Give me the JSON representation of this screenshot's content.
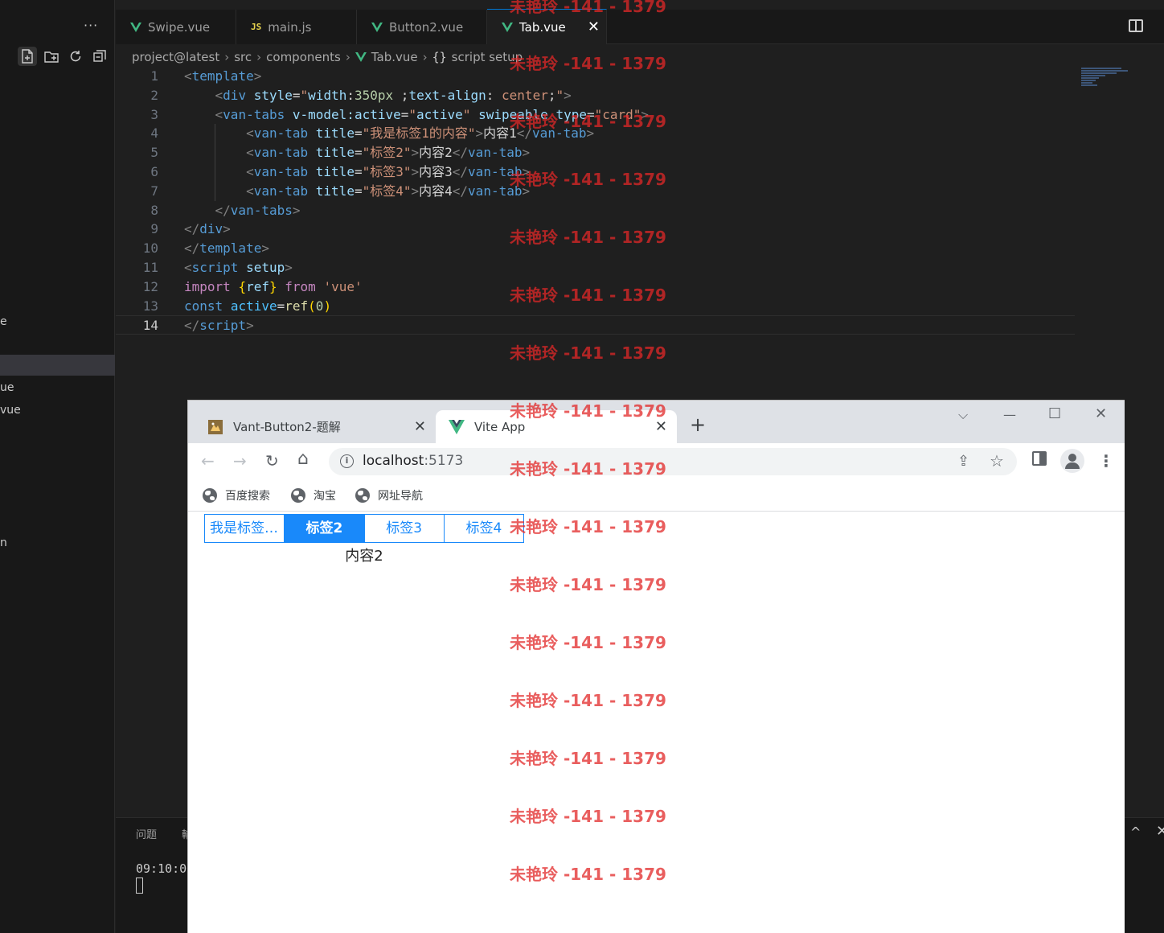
{
  "editor": {
    "sidebar": {
      "more": "···",
      "fragments": [
        "e",
        "ue",
        "vue",
        "n"
      ]
    },
    "tabs": [
      {
        "label": "Swipe.vue",
        "icon": "vue-icon"
      },
      {
        "label": "main.js",
        "icon": "js-icon",
        "icon_text": "JS"
      },
      {
        "label": "Button2.vue",
        "icon": "vue-icon"
      },
      {
        "label": "Tab.vue",
        "icon": "vue-icon",
        "active": true,
        "close": "✕"
      }
    ],
    "breadcrumb": [
      "project@latest",
      "src",
      "components",
      "Tab.vue",
      "script setup"
    ],
    "breadcrumb_brace": "{}",
    "current_line": 14,
    "panel": {
      "tab1": "问题",
      "tab2": "輸",
      "terminal_text": "09:10:0",
      "collapse": "^",
      "close": "✕"
    }
  },
  "browser": {
    "tabs": [
      {
        "title": "Vant-Button2-题解",
        "close": "✕"
      },
      {
        "title": "Vite App",
        "close": "✕",
        "active": true
      }
    ],
    "new_tab": "+",
    "window_controls": {
      "dropdown": "⌵",
      "minimize": "—",
      "maximize": "☐",
      "close": "✕"
    },
    "address": {
      "host": "localhost",
      "port": ":5173"
    },
    "bookmarks": [
      "百度搜索",
      "淘宝",
      "网址导航"
    ],
    "page": {
      "tabs": [
        "我是标签1的内容",
        "标签2",
        "标签3",
        "标签4"
      ],
      "active_index": 1,
      "content": "内容2",
      "accent_color": "#1989fa"
    }
  },
  "watermark": "未艳玲 -141 - 1379"
}
